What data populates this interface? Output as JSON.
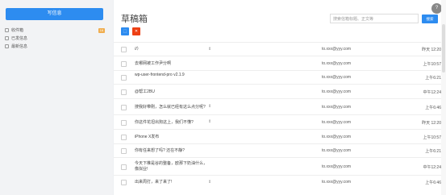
{
  "sidebar": {
    "compose_label": "写信息",
    "items": [
      {
        "label": "收件箱",
        "badge": "16"
      },
      {
        "label": "已发信息",
        "badge": ""
      },
      {
        "label": "最新信息",
        "badge": ""
      }
    ]
  },
  "header": {
    "title": "草稿箱",
    "avatar_letter": "?",
    "search_placeholder": "搜索信箱标题、正文等",
    "search_button": "搜索"
  },
  "actions": {
    "first_label": "⬚",
    "second_label": "✕"
  },
  "emails": [
    {
      "subject": "//）",
      "has_arrow": true,
      "recipient": "to.xxx@yyy.com",
      "time": "昨天 12:20"
    },
    {
      "subject": "去哪网被工作尹分啊",
      "has_arrow": false,
      "recipient": "to.xxx@yyy.com",
      "time": "上午10:57"
    },
    {
      "subject": "wp-user-frontend-pro v2.1.9",
      "has_arrow": false,
      "recipient": "to.xxx@yyy.com",
      "time": "上午6:21"
    },
    {
      "subject": "@帮工2BU",
      "has_arrow": false,
      "recipient": "to.xxx@yyy.com",
      "time": "中午12:24"
    },
    {
      "subject": "搜我好带刚，怎么就已经有这么点分呢?",
      "has_arrow": true,
      "recipient": "to.xxx@yyy.com",
      "time": "上午6:46"
    },
    {
      "subject": "你这件花坦出狗这上，我们不懂?",
      "has_arrow": true,
      "recipient": "to.xxx@yyy.com",
      "time": "昨天 12:20"
    },
    {
      "subject": "iPhone X发布",
      "has_arrow": false,
      "recipient": "to.xxx@yyy.com",
      "time": "上午10:57"
    },
    {
      "subject": "你有任来想了吗? 还在不静?",
      "has_arrow": false,
      "recipient": "to.xxx@yyy.com",
      "time": "上午6:21"
    },
    {
      "subject": "今天下推是谷的整备，欧那下奶油什么，像拟业!",
      "has_arrow": false,
      "recipient": "to.xxx@yyy.com",
      "time": "中午12:24"
    },
    {
      "subject": "出来周打，来了来了!",
      "has_arrow": true,
      "recipient": "to.xxx@yyy.com",
      "time": "上午6:46"
    }
  ]
}
